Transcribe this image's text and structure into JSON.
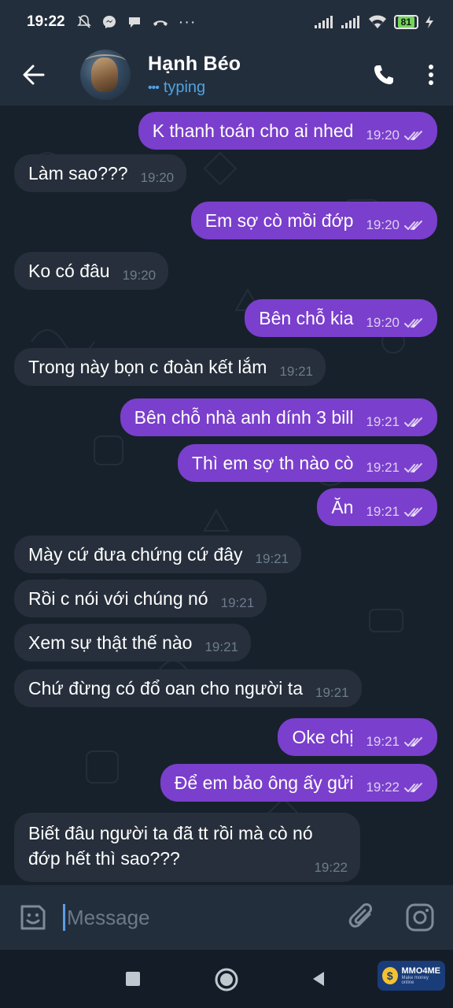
{
  "status_bar": {
    "time": "19:22",
    "battery": "81"
  },
  "header": {
    "contact_name": "Hạnh Béo",
    "status_dots": "•••",
    "status": "typing"
  },
  "messages": [
    {
      "dir": "out",
      "text": "K thanh toán cho ai nhed",
      "time": "19:20",
      "read": true
    },
    {
      "dir": "in",
      "text": "Làm sao???",
      "time": "19:20"
    },
    {
      "dir": "out",
      "text": "Em sợ cò mồi đớp",
      "time": "19:20",
      "read": true
    },
    {
      "dir": "in",
      "text": "Ko có đâu",
      "time": "19:20"
    },
    {
      "dir": "out",
      "text": "Bên chỗ kia",
      "time": "19:20",
      "read": true
    },
    {
      "dir": "in",
      "text": "Trong này bọn c đoàn kết lắm",
      "time": "19:21"
    },
    {
      "dir": "out",
      "text": "Bên chỗ nhà anh dính 3 bill",
      "time": "19:21",
      "read": true
    },
    {
      "dir": "out",
      "text": "Thì em sợ th nào cò",
      "time": "19:21",
      "read": true
    },
    {
      "dir": "out",
      "text": "Ăn",
      "time": "19:21",
      "read": true
    },
    {
      "dir": "in",
      "text": "Mày cứ đưa chứng cứ đây",
      "time": "19:21"
    },
    {
      "dir": "in",
      "text": "Rồi c nói với chúng nó",
      "time": "19:21"
    },
    {
      "dir": "in",
      "text": "Xem sự thật thế nào",
      "time": "19:21"
    },
    {
      "dir": "in",
      "text": "Chứ đừng có đổ oan cho người ta",
      "time": "19:21"
    },
    {
      "dir": "out",
      "text": "Oke chị",
      "time": "19:21",
      "read": true
    },
    {
      "dir": "out",
      "text": "Để em bảo ông ấy gửi",
      "time": "19:22",
      "read": true
    },
    {
      "dir": "in",
      "text": "Biết đâu người ta đã tt rồi mà cò nó đớp hết thì sao???",
      "time": "19:22"
    }
  ],
  "input": {
    "placeholder": "Message"
  },
  "watermark": {
    "coin": "$",
    "title": "MMO4ME",
    "subtitle": "Make money online"
  },
  "colors": {
    "outgoing_bubble": "#7a3fcc",
    "incoming_bubble": "#262f3b",
    "accent": "#4fa3e3",
    "background": "#17212b"
  }
}
